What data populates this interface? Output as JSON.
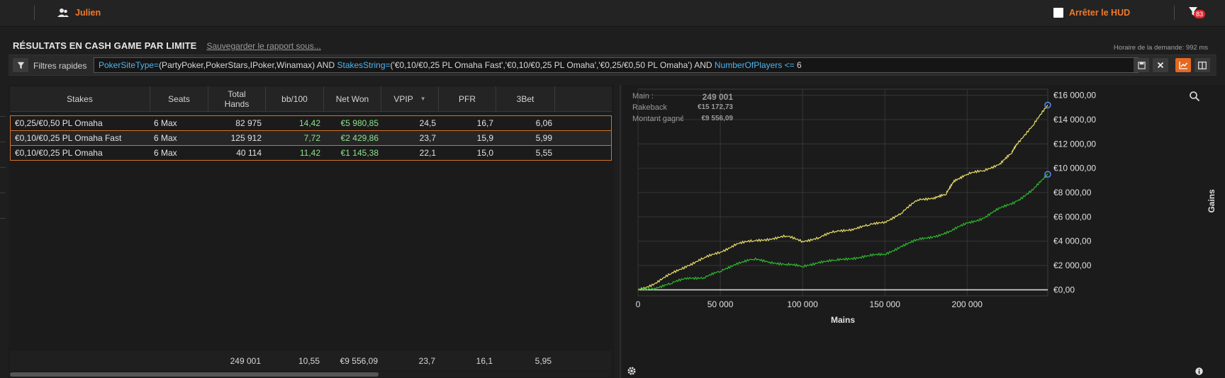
{
  "topbar": {
    "user_name": "Julien",
    "hud_label": "Arrêter le HUD",
    "notification_count": "83"
  },
  "header": {
    "title": "RÉSULTATS EN CASH GAME PAR LIMITE",
    "save_link": "Sauvegarder le rapport sous...",
    "timing": "Horaire de la demande: 992 ms"
  },
  "filter": {
    "label": "Filtres rapides",
    "tokens": [
      {
        "t": "PokerSiteType",
        "kw": true
      },
      {
        "t": "=",
        "kw": true
      },
      {
        "t": "(PartyPoker,PokerStars,IPoker,Winamax) AND ",
        "kw": false
      },
      {
        "t": "StakesString",
        "kw": true
      },
      {
        "t": "=",
        "kw": true
      },
      {
        "t": "('€0,10/€0,25 PL Omaha Fast','€0,10/€0,25 PL Omaha','€0,25/€0,50 PL Omaha') AND ",
        "kw": false
      },
      {
        "t": "NumberOfPlayers",
        "kw": true
      },
      {
        "t": " <= ",
        "kw": true
      },
      {
        "t": "6",
        "kw": false
      }
    ]
  },
  "table": {
    "columns": [
      {
        "label": "Stakes"
      },
      {
        "label": "Seats"
      },
      {
        "label": "Total\nHands"
      },
      {
        "label": "bb/100"
      },
      {
        "label": "Net Won"
      },
      {
        "label": "VPIP",
        "sorted": true
      },
      {
        "label": "PFR"
      },
      {
        "label": "3Bet"
      }
    ],
    "rows": [
      [
        "€0,25/€0,50 PL Omaha",
        "6 Max",
        "82 975",
        "14,42",
        "€5 980,85",
        "24,5",
        "16,7",
        "6,06"
      ],
      [
        "€0,10/€0,25 PL Omaha Fast",
        "6 Max",
        "125 912",
        "7,72",
        "€2 429,86",
        "23,7",
        "15,9",
        "5,99"
      ],
      [
        "€0,10/€0,25 PL Omaha",
        "6 Max",
        "40 114",
        "11,42",
        "€1 145,38",
        "22,1",
        "15,0",
        "5,55"
      ]
    ],
    "totals": [
      "",
      "",
      "249 001",
      "10,55",
      "€9 556,09",
      "23,7",
      "16,1",
      "5,95"
    ]
  },
  "legend": [
    {
      "label": "Main :",
      "value": "249 001"
    },
    {
      "label": "Rakeback",
      "value": "€15 172,73"
    },
    {
      "label": "Montant gagné",
      "value": "€9 556,09"
    }
  ],
  "chart_data": {
    "type": "line",
    "xlabel": "Mains",
    "ylabel": "Gains",
    "xlim": [
      0,
      249001
    ],
    "ylim": [
      -500,
      16500
    ],
    "x_ticks": [
      "0",
      "50 000",
      "100 000",
      "150 000",
      "200 000"
    ],
    "x_tick_values": [
      0,
      50000,
      100000,
      150000,
      200000
    ],
    "y_ticks": [
      "€0,00",
      "€2 000,00",
      "€4 000,00",
      "€6 000,00",
      "€8 000,00",
      "€10 000,00",
      "€12 000,00",
      "€14 000,00",
      "€16 000,00"
    ],
    "y_tick_values": [
      0,
      2000,
      4000,
      6000,
      8000,
      10000,
      12000,
      14000,
      16000
    ],
    "grid": true,
    "colors": {
      "total": "#e8de6a",
      "won": "#2eb82e",
      "zero": "#d9d9d9",
      "marker": "#5b8cf0"
    },
    "series": [
      {
        "key": "total",
        "x": [
          0,
          10000,
          20000,
          30000,
          40000,
          50000,
          60000,
          70000,
          80000,
          90000,
          100000,
          110000,
          120000,
          130000,
          140000,
          150000,
          160000,
          170000,
          180000,
          187000,
          192000,
          200000,
          210000,
          220000,
          227000,
          230000,
          240000,
          249001
        ],
        "values": [
          0,
          500,
          1300,
          2000,
          2600,
          3100,
          3800,
          4000,
          4200,
          4400,
          4000,
          4300,
          4800,
          5000,
          5300,
          5600,
          6300,
          7400,
          7600,
          7800,
          9000,
          9500,
          9800,
          10400,
          11200,
          12000,
          13500,
          15200
        ]
      },
      {
        "key": "won",
        "x": [
          0,
          10000,
          20000,
          30000,
          40000,
          50000,
          60000,
          70000,
          80000,
          90000,
          100000,
          110000,
          120000,
          130000,
          140000,
          150000,
          160000,
          170000,
          180000,
          190000,
          200000,
          210000,
          220000,
          230000,
          240000,
          249001
        ],
        "values": [
          0,
          150,
          500,
          1000,
          1000,
          1500,
          2200,
          2500,
          2300,
          2100,
          1900,
          2300,
          2400,
          2600,
          2800,
          2900,
          3600,
          4100,
          4400,
          4800,
          5500,
          5900,
          6700,
          7300,
          8200,
          9500
        ]
      }
    ]
  }
}
